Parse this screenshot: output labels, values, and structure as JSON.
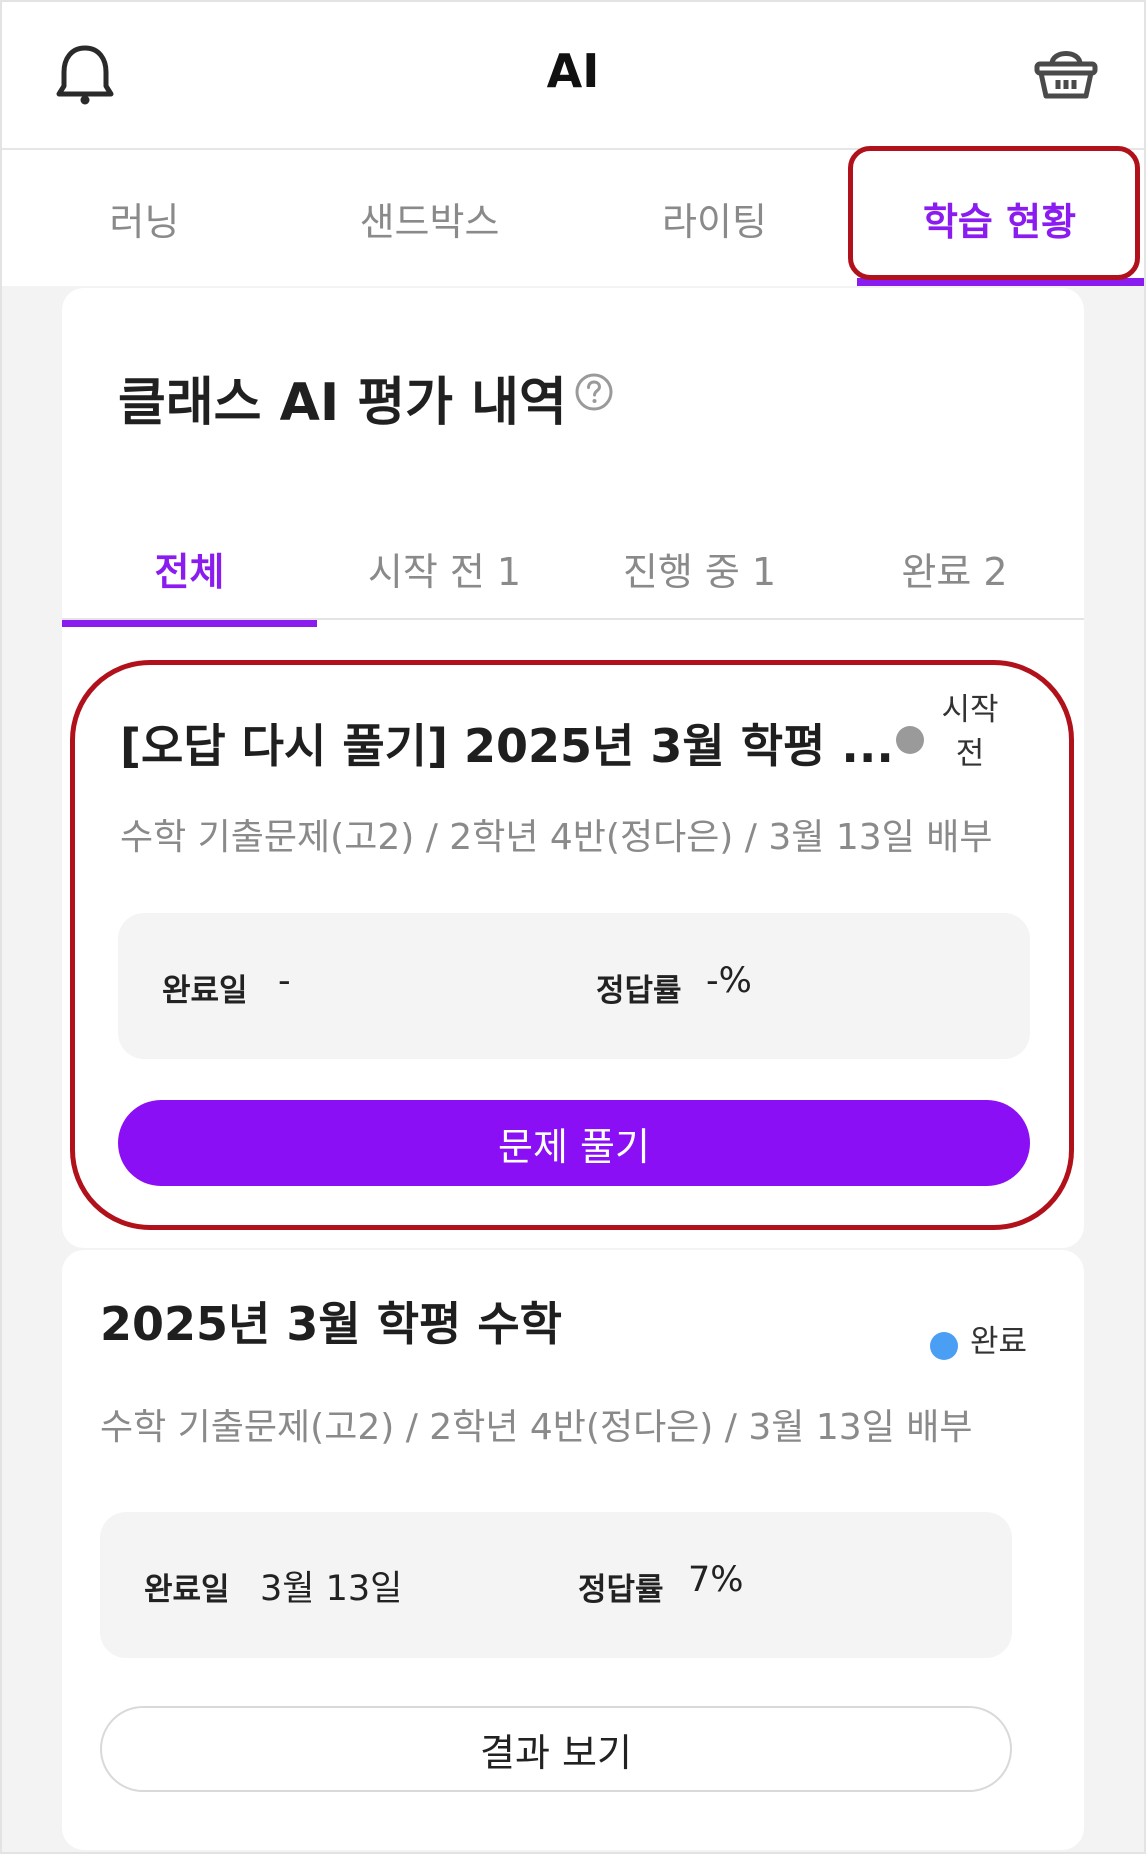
{
  "header": {
    "title": "AI",
    "left_icon": "bell-icon",
    "right_icon": "basket-icon"
  },
  "tabs": [
    {
      "label": "러닝",
      "active": false
    },
    {
      "label": "샌드박스",
      "active": false
    },
    {
      "label": "라이팅",
      "active": false
    },
    {
      "label": "학습 현황",
      "active": true
    }
  ],
  "section": {
    "title": "클래스 AI 평가 내역",
    "help_icon": "question-circle-icon",
    "subtabs": [
      {
        "label": "전체",
        "active": true
      },
      {
        "label": "시작 전 1",
        "active": false
      },
      {
        "label": "진행 중 1",
        "active": false
      },
      {
        "label": "완료 2",
        "active": false
      }
    ]
  },
  "items": [
    {
      "title": "[오답 다시 풀기] 2025년 3월 학평 ...",
      "status": "시작 전",
      "status_line1": "시작",
      "status_line2": "전",
      "status_color": "#9a9a9a",
      "subtitle": "수학 기출문제(고2) / 2학년 4반(정다은) / 3월 13일 배부",
      "completed_label": "완료일",
      "completed_value": "-",
      "accuracy_label": "정답률",
      "accuracy_value": "-%",
      "button": "문제 풀기"
    },
    {
      "title": "2025년 3월 학평 수학",
      "status": "완료",
      "status_color": "#4a9ff5",
      "subtitle": "수학 기출문제(고2) / 2학년 4반(정다은) / 3월 13일 배부",
      "completed_label": "완료일",
      "completed_value": "3월 13일",
      "accuracy_label": "정답률",
      "accuracy_value": "7%",
      "button": "결과 보기"
    }
  ],
  "colors": {
    "accent": "#8a0ff5",
    "highlight": "#b1111b"
  }
}
